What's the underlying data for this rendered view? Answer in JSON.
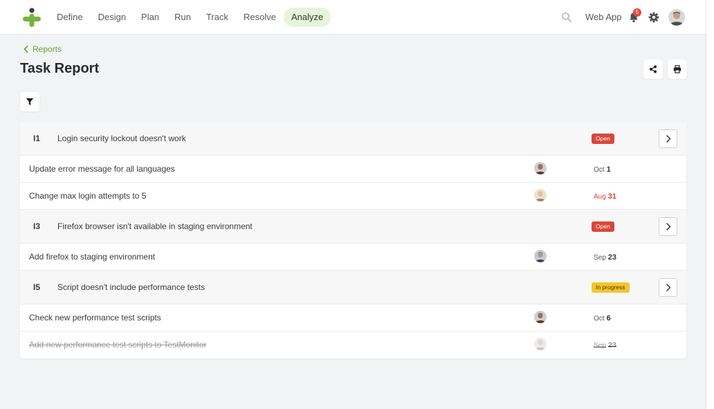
{
  "nav": {
    "items": [
      {
        "label": "Define",
        "active": false
      },
      {
        "label": "Design",
        "active": false
      },
      {
        "label": "Plan",
        "active": false
      },
      {
        "label": "Run",
        "active": false
      },
      {
        "label": "Track",
        "active": false
      },
      {
        "label": "Resolve",
        "active": false
      },
      {
        "label": "Analyze",
        "active": true
      }
    ],
    "workspace_label": "Web App",
    "notification_count": "5"
  },
  "colors": {
    "accent": "#6aa038",
    "logo_green": "#77b43f",
    "logo_dark": "#3a3f4a",
    "open": "#d9473a",
    "in_progress": "#f4c430"
  },
  "breadcrumb": {
    "label": "Reports"
  },
  "page": {
    "title": "Task Report"
  },
  "toolbar": {
    "share_icon": "share-icon",
    "print_icon": "print-icon",
    "filter_icon": "filter-icon"
  },
  "report": {
    "groups": [
      {
        "id": "I1",
        "title": "Login security lockout doesn't work",
        "status": "Open",
        "status_type": "open",
        "tasks": [
          {
            "title": "Update error message for all languages",
            "month": "Oct",
            "day": "1",
            "late": false,
            "done": false,
            "avatar": "a"
          },
          {
            "title": "Change max login attempts to 5",
            "month": "Aug",
            "day": "31",
            "late": true,
            "done": false,
            "avatar": "b"
          }
        ]
      },
      {
        "id": "I3",
        "title": "Firefox browser isn't available in staging environment",
        "status": "Open",
        "status_type": "open",
        "tasks": [
          {
            "title": "Add firefox to staging environment",
            "month": "Sep",
            "day": "23",
            "late": false,
            "done": false,
            "avatar": "c"
          }
        ]
      },
      {
        "id": "I5",
        "title": "Script doesn't include performance tests",
        "status": "In progress",
        "status_type": "progress",
        "tasks": [
          {
            "title": "Check new performance test scripts",
            "month": "Oct",
            "day": "6",
            "late": false,
            "done": false,
            "avatar": "a"
          },
          {
            "title": "Add new performance test scripts to TestMonitor",
            "month": "Sep",
            "day": "23",
            "late": false,
            "done": true,
            "avatar": "d"
          }
        ]
      }
    ]
  }
}
